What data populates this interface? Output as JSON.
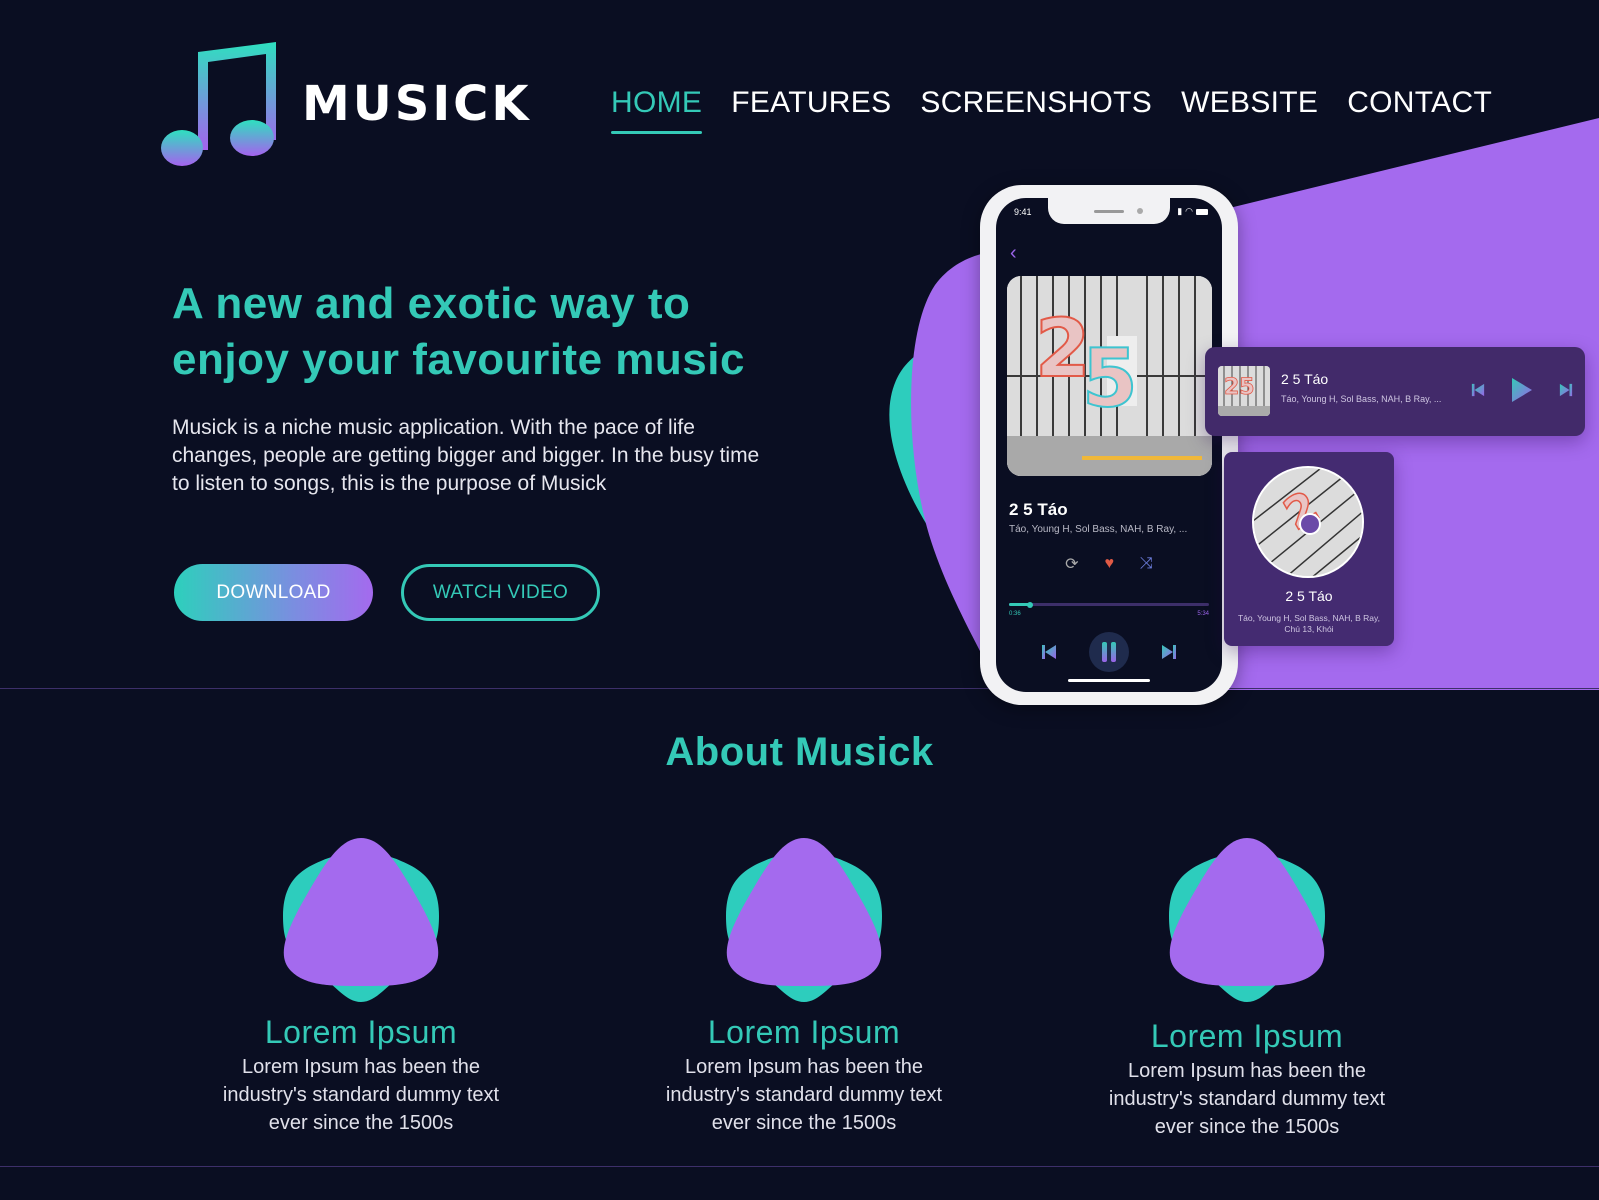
{
  "brand": {
    "name": "MUSICK",
    "colors": {
      "background": "#0a0e22",
      "teal": "#34c9b7",
      "purple": "#a46aee",
      "card": "#442b71"
    }
  },
  "nav": {
    "items": [
      {
        "label": "HOME",
        "active": true
      },
      {
        "label": "FEATURES",
        "active": false
      },
      {
        "label": "SCREENSHOTS",
        "active": false
      },
      {
        "label": "WEBSITE",
        "active": false
      },
      {
        "label": "CONTACT",
        "active": false
      }
    ]
  },
  "hero": {
    "title": "A new and exotic way to enjoy your favourite music",
    "description": "Musick is a niche music application. With the pace of life changes, people are getting bigger and bigger. In the busy time to listen to songs, this is the purpose of Musick",
    "download_label": "DOWNLOAD",
    "watch_label": "WATCH VIDEO"
  },
  "phone": {
    "status_time": "9:41",
    "song_title": "2 5 Táo",
    "song_artists": "Táo, Young H, Sol Bass, NAH, B Ray, ...",
    "current_time": "0:36",
    "total_time": "5:34",
    "progress_fraction": 0.11,
    "liked": true,
    "state": "playing"
  },
  "mini_player": {
    "song_title": "2 5 Táo",
    "song_artists": "Táo, Young H, Sol Bass, NAH, B Ray, ...",
    "state": "paused"
  },
  "disc_card": {
    "song_title": "2 5 Táo",
    "song_artists": "Táo, Young H, Sol Bass, NAH, B Ray, Chú 13, Khói"
  },
  "about": {
    "title": "About Musick",
    "features": [
      {
        "title": "Lorem Ipsum",
        "description": "Lorem Ipsum has been the industry's standard dummy text ever since the 1500s"
      },
      {
        "title": "Lorem Ipsum",
        "description": "Lorem Ipsum has been the industry's standard dummy text ever since the 1500s"
      },
      {
        "title": "Lorem Ipsum",
        "description": "Lorem Ipsum has been the industry's standard dummy text ever since the 1500s"
      }
    ]
  }
}
